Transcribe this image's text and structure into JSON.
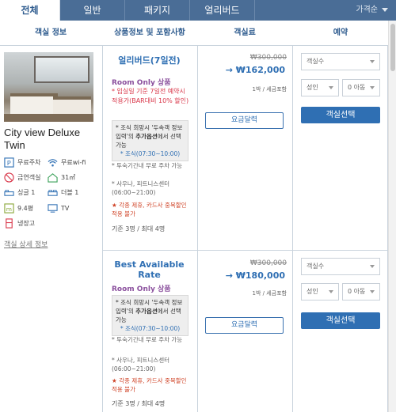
{
  "tabs": [
    {
      "label": "전체"
    },
    {
      "label": "일반"
    },
    {
      "label": "패키지"
    },
    {
      "label": "얼리버드"
    }
  ],
  "sort_label": "가격순",
  "columns": [
    "객실 정보",
    "상품정보 및 포함사항",
    "객실료",
    "예약"
  ],
  "room": {
    "name": "City view Deluxe Twin",
    "amenities": [
      {
        "icon": "parking-icon",
        "label": "무료주차"
      },
      {
        "icon": "wifi-icon",
        "label": "무료wi-fi"
      },
      {
        "icon": "no-smoking-icon",
        "label": "금연객실"
      },
      {
        "icon": "room-size-icon",
        "label": "31㎡"
      },
      {
        "icon": "single-bed-icon",
        "label": "싱글 1"
      },
      {
        "icon": "double-bed-icon",
        "label": "더블 1"
      },
      {
        "icon": "area-icon",
        "label": "9.4평"
      },
      {
        "icon": "tv-icon",
        "label": "TV"
      },
      {
        "icon": "fridge-icon",
        "label": "냉장고"
      }
    ],
    "detail_link": "객실 상세 정보"
  },
  "plans": [
    {
      "title": "얼리버드(7일전)",
      "type": "Room Only 상품",
      "promo_note": "* 입실일 기준 7일전 예약시 적용가(BAR대비 10% 할인)",
      "breakfast_note_pre": "* 조식 희망시 '두속객 정보입력'의 ",
      "breakfast_note_bold": "추가옵션",
      "breakfast_note_post": "에서 선택 가능",
      "breakfast_time": "* 조식(07:30~10:00)",
      "parking_note": "* 투숙기간내 무료 주차 가능",
      "facility_note": "* 사우나, 피트니스센터 (06:00~21:00)",
      "warning": "★ 각종 제휴, 카드사 중복할인 적용 불가",
      "capacity": "기준 3명 / 최대 4명",
      "original_price": "₩300,000",
      "price": "→ ₩162,000",
      "per_night": "1박 / 세금포함",
      "calendar_button": "요금달력",
      "room_count_placeholder": "객실수",
      "adult_placeholder": "성인",
      "child_placeholder": "0 아동",
      "book_button": "객실선택"
    },
    {
      "title": "Best Available Rate",
      "type": "Room Only 상품",
      "breakfast_note_pre": "* 조식 희망시 '두속객 정보입력'의 ",
      "breakfast_note_bold": "추가옵션",
      "breakfast_note_post": "에서 선택 가능",
      "breakfast_time": "* 조식(07:30~10:00)",
      "parking_note": "* 투숙기간내 무료 주차 가능",
      "facility_note": "* 사우나, 피트니스센터 (06:00~21:00)",
      "warning": "★ 각종 제휴, 카드사 중복할인 적용 불가",
      "capacity": "기준 3명 / 최대 4명",
      "original_price": "₩300,000",
      "price": "→ ₩180,000",
      "per_night": "1박 / 세금포함",
      "calendar_button": "요금달력",
      "room_count_placeholder": "객실수",
      "adult_placeholder": "성인",
      "child_placeholder": "0 아동",
      "book_button": "객실선택"
    }
  ]
}
